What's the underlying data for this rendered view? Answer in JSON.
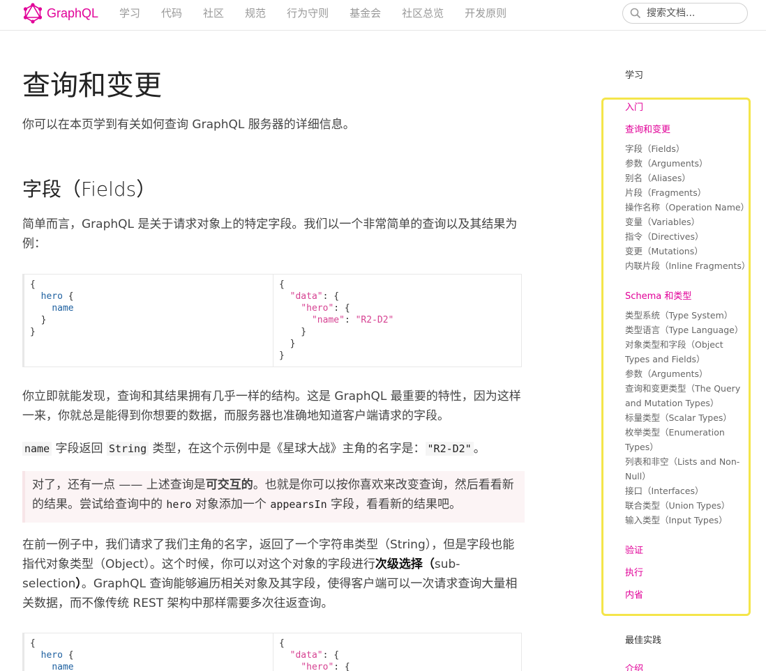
{
  "header": {
    "logo_text": "GraphQL",
    "nav": [
      "学习",
      "代码",
      "社区",
      "规范",
      "行为守则",
      "基金会",
      "社区总览",
      "开发原则"
    ],
    "search_placeholder": "搜索文档..."
  },
  "main": {
    "title": "查询和变更",
    "intro": "你可以在本页学到有关如何查询 GraphQL 服务器的详细信息。",
    "h2_fields": "字段（Fields）",
    "p1": "简单而言，GraphQL 是关于请求对象上的特定字段。我们以一个非常简单的查询以及其结果为例：",
    "p2": "你立即就能发现，查询和其结果拥有几乎一样的结构。这是 GraphQL 最重要的特性，因为这样一来，你就总是能得到你想要的数据，而服务器也准确地知道客户端请求的字段。",
    "p3": {
      "code1": "name",
      "t1": " 字段返回 ",
      "code2": "String",
      "t2": " 类型，在这个示例中是《星球大战》主角的名字是：",
      "code3": "\"R2-D2\"",
      "t3": "。"
    },
    "note": {
      "t1": "对了，还有一点 —— 上述查询是",
      "bold": "可交互的",
      "t2": "。也就是你可以按你喜欢来改变查询，然后看看新的结果。尝试给查询中的 ",
      "code1": "hero",
      "t3": " 对象添加一个 ",
      "code2": "appearsIn",
      "t4": " 字段，看看新的结果吧。"
    },
    "p4": {
      "t1": "在前一例子中，我们请求了我们主角的名字，返回了一个字符串类型（String），但是字段也能指代对象类型（Object）。这个时候，你可以对这个对象的字段进行",
      "bold": "次级选择（",
      "t2": "sub-selection",
      "bold2": "）",
      "t3": "。GraphQL 查询能够遍历相关对象及其字段，使得客户端可以一次请求查询大量相关数据，而不像传统 REST 架构中那样需要多次往返查询。"
    }
  },
  "sidebar": {
    "section1": "学习",
    "intro": "入门",
    "queries": "查询和变更",
    "queries_items": [
      "字段（Fields）",
      "参数（Arguments）",
      "别名（Aliases）",
      "片段（Fragments）",
      "操作名称（Operation Name）",
      "变量（Variables）",
      "指令（Directives）",
      "变更（Mutations）",
      "内联片段（Inline Fragments）"
    ],
    "schema": "Schema 和类型",
    "schema_items": [
      "类型系统（Type System）",
      "类型语言（Type Language）",
      "对象类型和字段（Object",
      "Types and Fields）",
      "参数（Arguments）",
      "查询和变更类型（The Query",
      "and Mutation Types）",
      "标量类型（Scalar Types）",
      "枚举类型（Enumeration",
      "Types）",
      "列表和非空（Lists and Non-",
      "Null）",
      "接口（Interfaces）",
      "联合类型（Union Types）",
      "输入类型（Input Types）"
    ],
    "validation": "验证",
    "execution": "执行",
    "introspection": "内省",
    "section2": "最佳实践",
    "cut_item": "介绍"
  }
}
